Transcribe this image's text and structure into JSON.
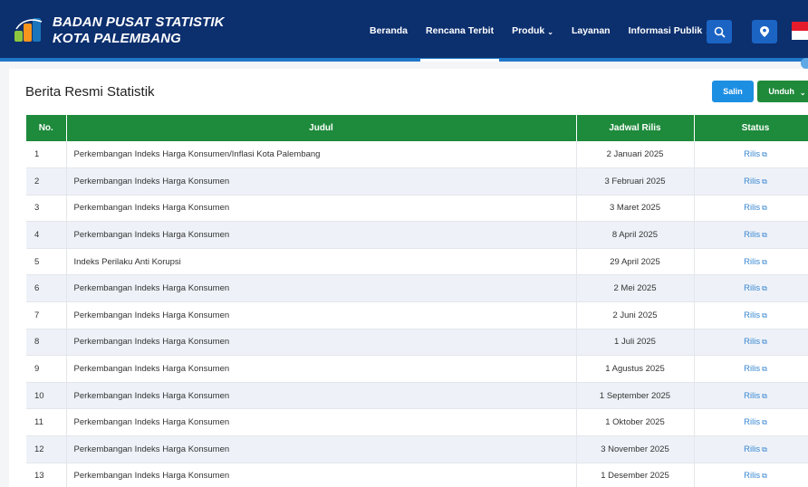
{
  "header": {
    "brand_line1": "BADAN PUSAT STATISTIK",
    "brand_line2": "KOTA PALEMBANG",
    "nav": [
      {
        "label": "Beranda"
      },
      {
        "label": "Rencana Terbit"
      },
      {
        "label": "Produk"
      },
      {
        "label": "Layanan"
      },
      {
        "label": "Informasi Publik"
      }
    ],
    "accent_color": "#0c2f6e"
  },
  "main": {
    "title": "Berita Resmi Statistik",
    "copy_label": "Salin",
    "download_label": "Unduh",
    "columns": [
      "No.",
      "Judul",
      "Jadwal Rilis",
      "Status"
    ],
    "rows": [
      {
        "no": "1",
        "judul": "Perkembangan Indeks Harga Konsumen/Inflasi Kota Palembang",
        "jadwal": "2 Januari 2025",
        "status": "Rilis"
      },
      {
        "no": "2",
        "judul": "Perkembangan Indeks Harga Konsumen",
        "jadwal": "3 Februari 2025",
        "status": "Rilis"
      },
      {
        "no": "3",
        "judul": "Perkembangan Indeks Harga Konsumen",
        "jadwal": "3 Maret 2025",
        "status": "Rilis"
      },
      {
        "no": "4",
        "judul": "Perkembangan Indeks Harga Konsumen",
        "jadwal": "8 April 2025",
        "status": "Rilis"
      },
      {
        "no": "5",
        "judul": "Indeks Perilaku Anti Korupsi",
        "jadwal": "29 April 2025",
        "status": "Rilis"
      },
      {
        "no": "6",
        "judul": "Perkembangan Indeks Harga Konsumen",
        "jadwal": "2 Mei 2025",
        "status": "Rilis"
      },
      {
        "no": "7",
        "judul": "Perkembangan Indeks Harga Konsumen",
        "jadwal": "2 Juni 2025",
        "status": "Rilis"
      },
      {
        "no": "8",
        "judul": "Perkembangan Indeks Harga Konsumen",
        "jadwal": "1 Juli 2025",
        "status": "Rilis"
      },
      {
        "no": "9",
        "judul": "Perkembangan Indeks Harga Konsumen",
        "jadwal": "1 Agustus 2025",
        "status": "Rilis"
      },
      {
        "no": "10",
        "judul": "Perkembangan Indeks Harga Konsumen",
        "jadwal": "1 September 2025",
        "status": "Rilis"
      },
      {
        "no": "11",
        "judul": "Perkembangan Indeks Harga Konsumen",
        "jadwal": "1 Oktober 2025",
        "status": "Rilis"
      },
      {
        "no": "12",
        "judul": "Perkembangan Indeks Harga Konsumen",
        "jadwal": "3 November 2025",
        "status": "Rilis"
      },
      {
        "no": "13",
        "judul": "Perkembangan Indeks Harga Konsumen",
        "jadwal": "1 Desember 2025",
        "status": "Rilis"
      }
    ],
    "header_color": "#1e8a3b",
    "status_color": "#3a87d1"
  },
  "icons": {
    "logo": "bps-logo-icon",
    "search": "search-icon",
    "location": "map-pin-icon",
    "flag": "indonesia-flag-icon",
    "external": "external-link-icon"
  }
}
